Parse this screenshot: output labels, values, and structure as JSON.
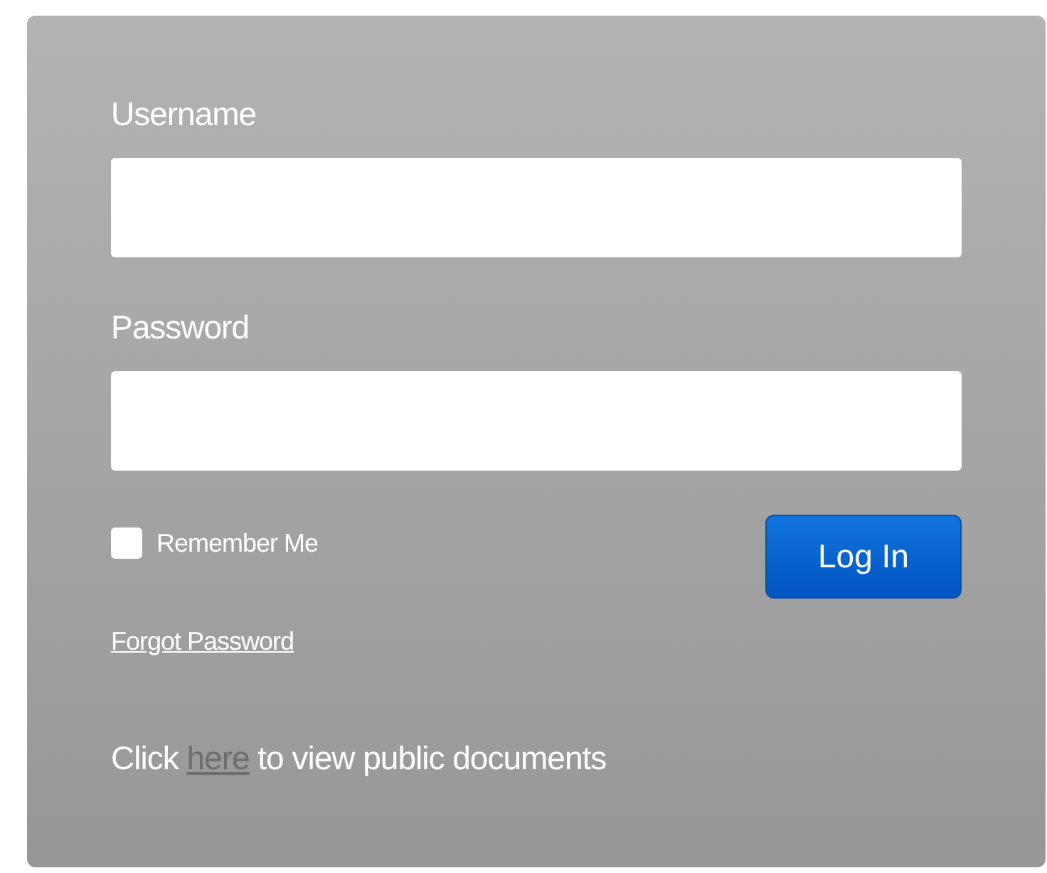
{
  "fields": [
    {
      "label": "Username"
    },
    {
      "label": "Password"
    }
  ],
  "remember": {
    "label": "Remember Me",
    "checked": false
  },
  "login_button": "Log In",
  "forgot_link": "Forgot Password",
  "public_note": {
    "before": "Click",
    "link": "here",
    "after": "to view public documents"
  }
}
